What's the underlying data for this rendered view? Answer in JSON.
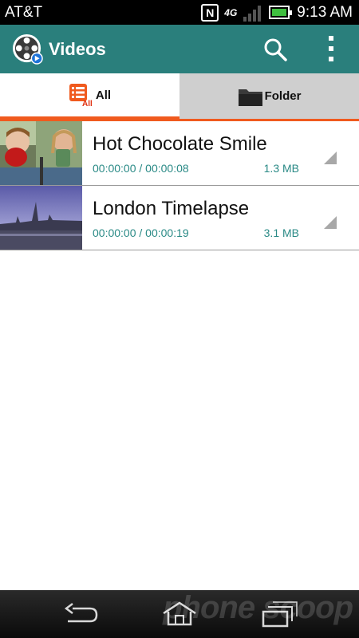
{
  "status_bar": {
    "carrier": "AT&T",
    "nfc": "N",
    "network": "4G",
    "time": "9:13 AM"
  },
  "app_bar": {
    "title": "Videos"
  },
  "tabs": [
    {
      "label": "All",
      "icon_badge": "All",
      "selected": true
    },
    {
      "label": "Folder",
      "selected": false
    }
  ],
  "videos": [
    {
      "title": "Hot Chocolate Smile",
      "duration": "00:00:00 / 00:00:08",
      "size": "1.3 MB"
    },
    {
      "title": "London Timelapse",
      "duration": "00:00:00 / 00:00:19",
      "size": "3.1 MB"
    }
  ],
  "watermark": "phone scoop",
  "colors": {
    "app_bar": "#2a7f7c",
    "accent": "#f05a1e",
    "meta_text": "#2a8a86"
  }
}
